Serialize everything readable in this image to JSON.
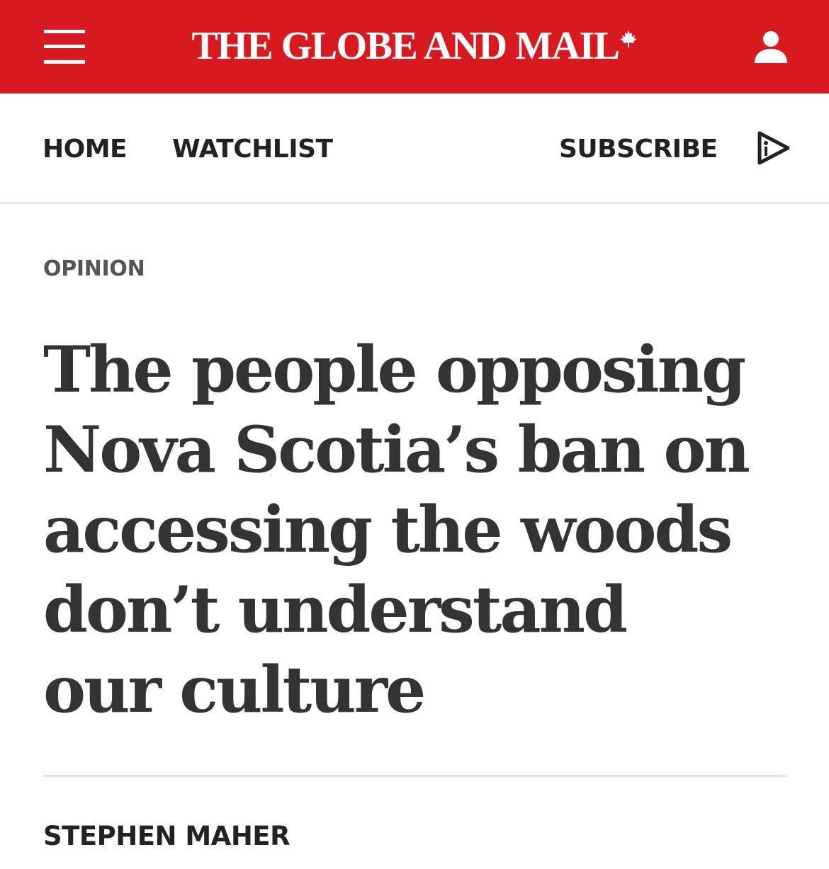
{
  "masthead": {
    "brand": "THE GLOBE AND MAIL",
    "background_color": "#d71920",
    "menu_icon": "hamburger-menu-icon",
    "logo_icon": "maple-leaf-icon",
    "account_icon": "user-account-icon"
  },
  "nav": {
    "home": "HOME",
    "watchlist": "WATCHLIST",
    "subscribe": "SUBSCRIBE",
    "video_icon": "play-video-icon"
  },
  "article": {
    "section": "OPINION",
    "headline": "The people opposing Nova Scotia’s ban on accessing the woods don’t understand our culture",
    "byline": "STEPHEN MAHER"
  }
}
